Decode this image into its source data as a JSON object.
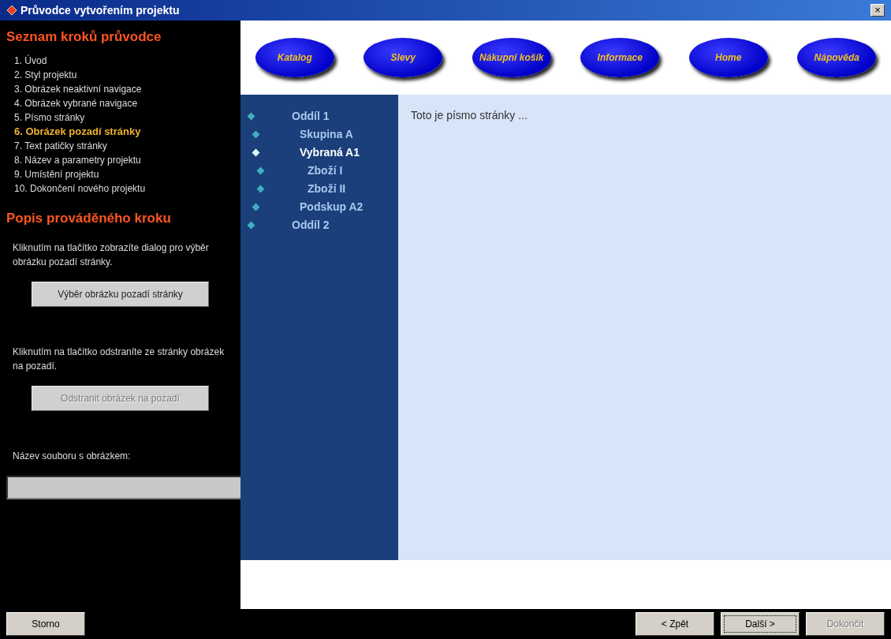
{
  "window": {
    "title": "Průvodce vytvořením projektu",
    "close_glyph": "×"
  },
  "steps": {
    "heading": "Seznam kroků průvodce",
    "items": [
      {
        "label": "1. Úvod",
        "selected": false
      },
      {
        "label": "2. Styl projektu",
        "selected": false
      },
      {
        "label": "3. Obrázek neaktivní navigace",
        "selected": false
      },
      {
        "label": "4. Obrázek vybrané navigace",
        "selected": false
      },
      {
        "label": "5. Písmo stránky",
        "selected": false
      },
      {
        "label": "6. Obrázek pozadí stránky",
        "selected": true
      },
      {
        "label": "7. Text patičky stránky",
        "selected": false
      },
      {
        "label": "8. Název a parametry projektu",
        "selected": false
      },
      {
        "label": "9. Umístění projektu",
        "selected": false
      },
      {
        "label": "10. Dokončení nového projektu",
        "selected": false
      }
    ]
  },
  "description": {
    "heading": "Popis prováděného kroku",
    "blocks": [
      {
        "text": "Kliknutím na tlačítko zobrazíte dialog pro výběr obrázku pozadí stránky.",
        "button": "Výběr obrázku pozadí stránky",
        "disabled": false
      },
      {
        "text": "Kliknutím na tlačítko odstraníte ze stránky obrázek na pozadí.",
        "button": "Odstranit obrázek na pozadí",
        "disabled": true
      }
    ],
    "file_label": "Název souboru s obrázkem:"
  },
  "preview": {
    "nav_buttons": [
      "Katalog",
      "Slevy",
      "Nákupní košík",
      "Informace",
      "Home",
      "Nápověda"
    ],
    "tree": [
      {
        "label": "Oddíl 1",
        "selected": false,
        "children": [
          {
            "label": "Skupina A",
            "selected": false
          },
          {
            "label": "Vybraná A1",
            "selected": true,
            "children": [
              {
                "label": "Zboží I",
                "selected": false
              },
              {
                "label": "Zboží II",
                "selected": false
              }
            ]
          },
          {
            "label": "Podskup A2",
            "selected": false
          }
        ]
      },
      {
        "label": "Oddíl 2",
        "selected": false
      }
    ],
    "content_text": "Toto je písmo stránky ..."
  },
  "footer_left_buttons": [
    {
      "label": "Storno",
      "disabled": false,
      "default": false
    }
  ],
  "footer_right_buttons": [
    {
      "label": "< Zpět",
      "disabled": false,
      "default": false
    },
    {
      "label": "Další >",
      "disabled": false,
      "default": true
    },
    {
      "label": "Dokončit",
      "disabled": true,
      "default": false
    }
  ]
}
